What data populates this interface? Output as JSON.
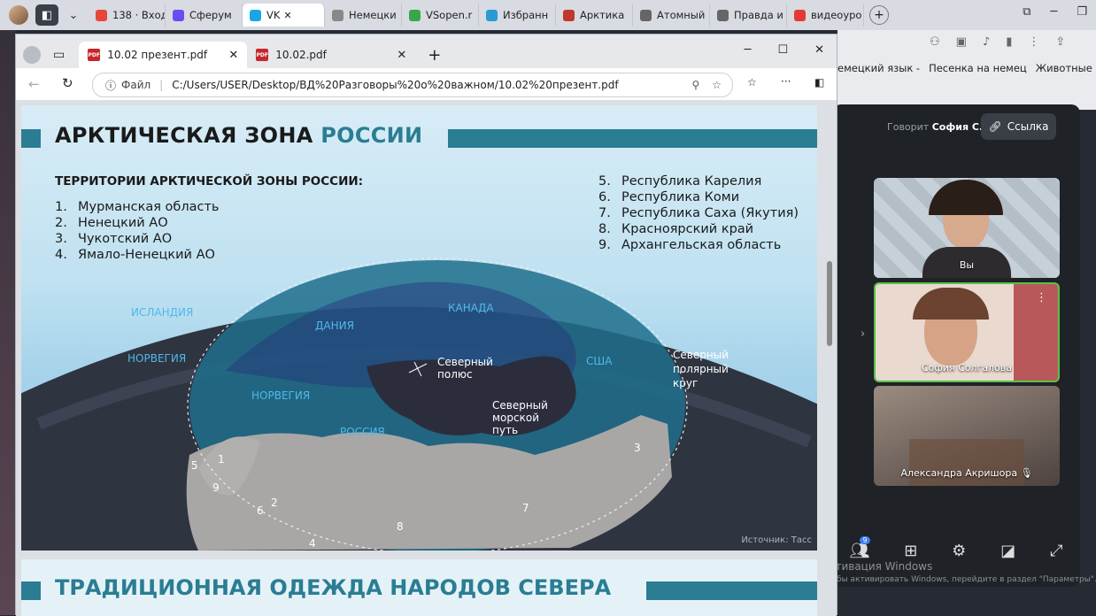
{
  "top_tabs": [
    {
      "label": "138 · Вход",
      "color": "#e6473a"
    },
    {
      "label": "Сферум",
      "color": "#6a4cf0"
    },
    {
      "label": "VK ",
      "color": "#1aa6e6",
      "active": true
    },
    {
      "label": "Немецки",
      "color": "#888888"
    },
    {
      "label": "VSopen.r",
      "color": "#3aa64a"
    },
    {
      "label": "Избранн",
      "color": "#2a9ad6"
    },
    {
      "label": "Арктика",
      "color": "#c0392b"
    },
    {
      "label": "Атомный",
      "color": "#666666"
    },
    {
      "label": "Правда и",
      "color": "#666666"
    },
    {
      "label": "видеоуро",
      "color": "#e53935"
    }
  ],
  "bg_bookmarks": [
    "емецкий язык -",
    "Песенка на немец",
    "Животные"
  ],
  "pdf_tabs": [
    "10.02 презент.pdf",
    "10.02.pdf"
  ],
  "url_label": "Файл",
  "url": "C:/Users/USER/Desktop/ВД%20Разговоры%20о%20важном/10.02%20презент.pdf",
  "slide1": {
    "title_a": "АРКТИЧЕСКАЯ ЗОНА",
    "title_b": "РОССИИ",
    "subtitle": "ТЕРРИТОРИИ АРКТИЧЕСКОЙ ЗОНЫ РОССИИ:",
    "left_list": [
      {
        "n": "1.",
        "t": "Мурманская область"
      },
      {
        "n": "2.",
        "t": "Ненецкий АО"
      },
      {
        "n": "3.",
        "t": "Чукотский АО"
      },
      {
        "n": "4.",
        "t": "Ямало-Ненецкий АО"
      }
    ],
    "right_list": [
      {
        "n": "5.",
        "t": "Республика Карелия"
      },
      {
        "n": "6.",
        "t": "Республика Коми"
      },
      {
        "n": "7.",
        "t": "Республика Саха (Якутия)"
      },
      {
        "n": "8.",
        "t": "Красноярский край"
      },
      {
        "n": "9.",
        "t": "Архангельская область"
      }
    ],
    "map_labels": {
      "iceland": "ИСЛАНДИЯ",
      "denmark": "ДАНИЯ",
      "canada": "КАНАДА",
      "norway1": "НОРВЕГИЯ",
      "norway2": "НОРВЕГИЯ",
      "usa": "США",
      "russia": "РОССИЯ",
      "pole1": "Северный",
      "pole2": "полюс",
      "route1": "Северный",
      "route2": "морской",
      "route3": "путь",
      "circle1": "Северный",
      "circle2": "полярный",
      "circle3": "круг"
    },
    "numbers": [
      "1",
      "2",
      "3",
      "4",
      "5",
      "6",
      "7",
      "8",
      "9"
    ],
    "source": "Источник: Тасс"
  },
  "slide2": {
    "title_a": "ТРАДИЦИОННАЯ ОДЕЖДА",
    "title_b": "НАРОДОВ СЕВЕРА"
  },
  "call": {
    "talking_prefix": "Говорит",
    "talking_name": "София С.",
    "link_label": "Ссылка",
    "participants": [
      "Вы",
      "София Солгалова",
      "Александра Акришора"
    ],
    "badge": "9"
  },
  "windows_activation": {
    "line1": "Активация Windows",
    "line2": "Чтобы активировать Windows, перейдите в раздел \"Параметры\"."
  }
}
